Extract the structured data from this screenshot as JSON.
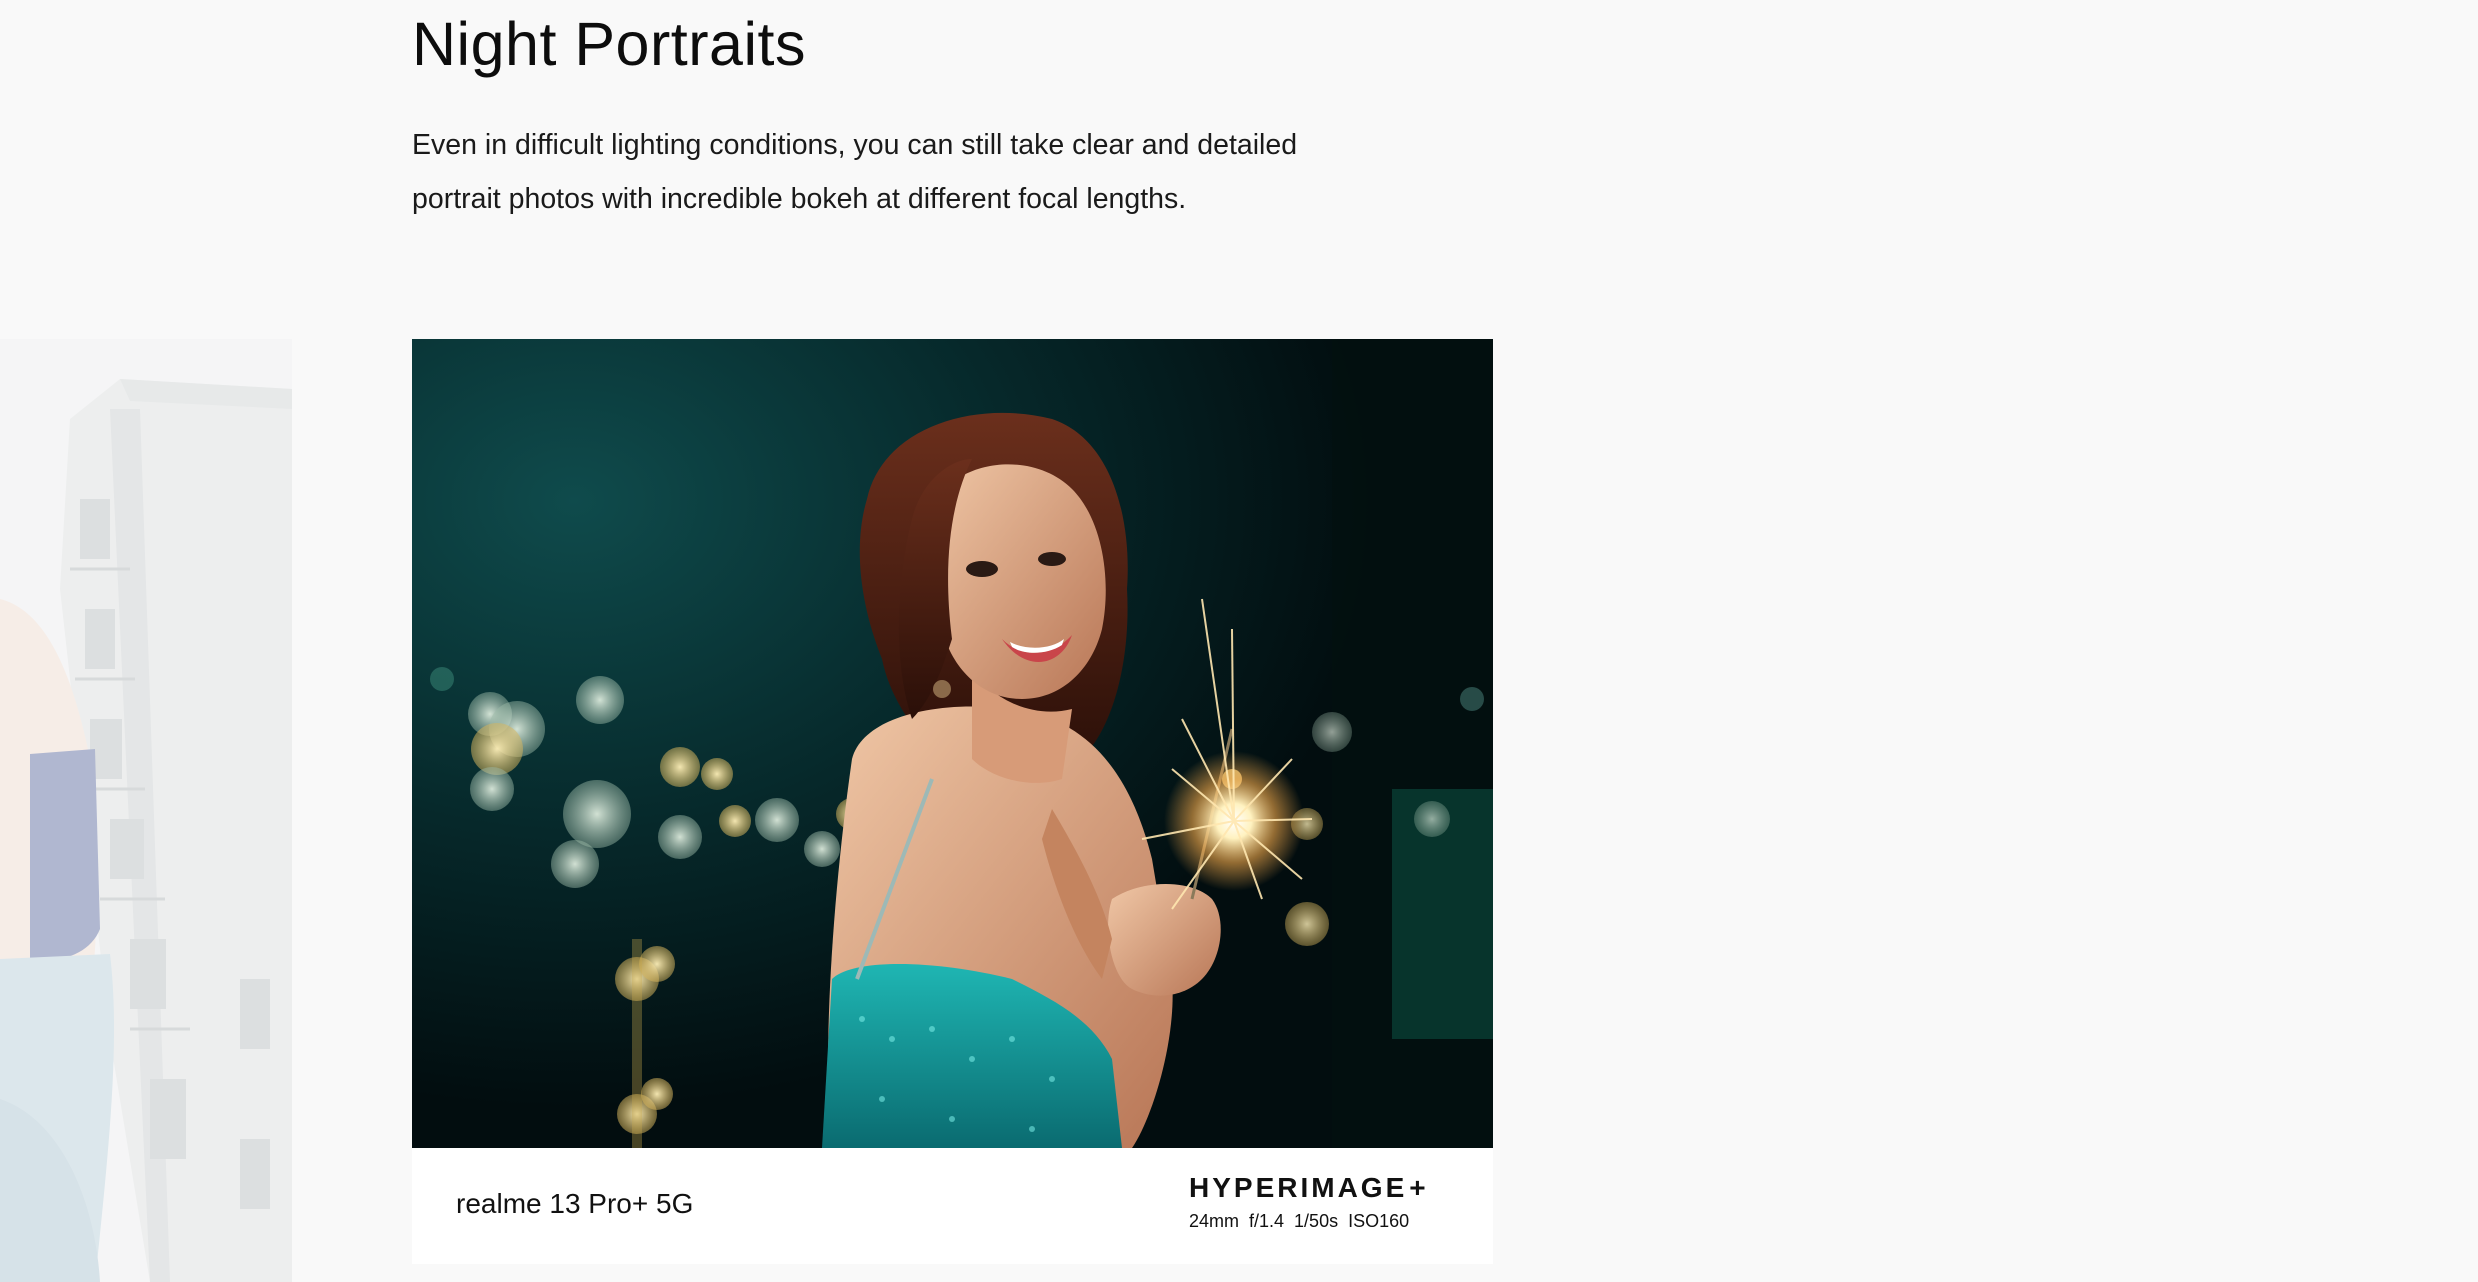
{
  "section": {
    "title": "Night Portraits",
    "description": "Even in difficult lighting conditions, you can still take clear and detailed portrait photos with incredible bokeh at different focal lengths."
  },
  "sample_card": {
    "device_name": "realme 13 Pro+ 5G",
    "brand_logo": "HYPERIMAGE",
    "brand_logo_suffix": "+",
    "specs": {
      "focal_length": "24mm",
      "aperture": "f/1.4",
      "shutter": "1/50s",
      "iso": "ISO160"
    }
  },
  "colors": {
    "page_background": "#f9f9f9",
    "card_background": "#ffffff",
    "photo_background": "#06191b",
    "text": "#111111"
  }
}
